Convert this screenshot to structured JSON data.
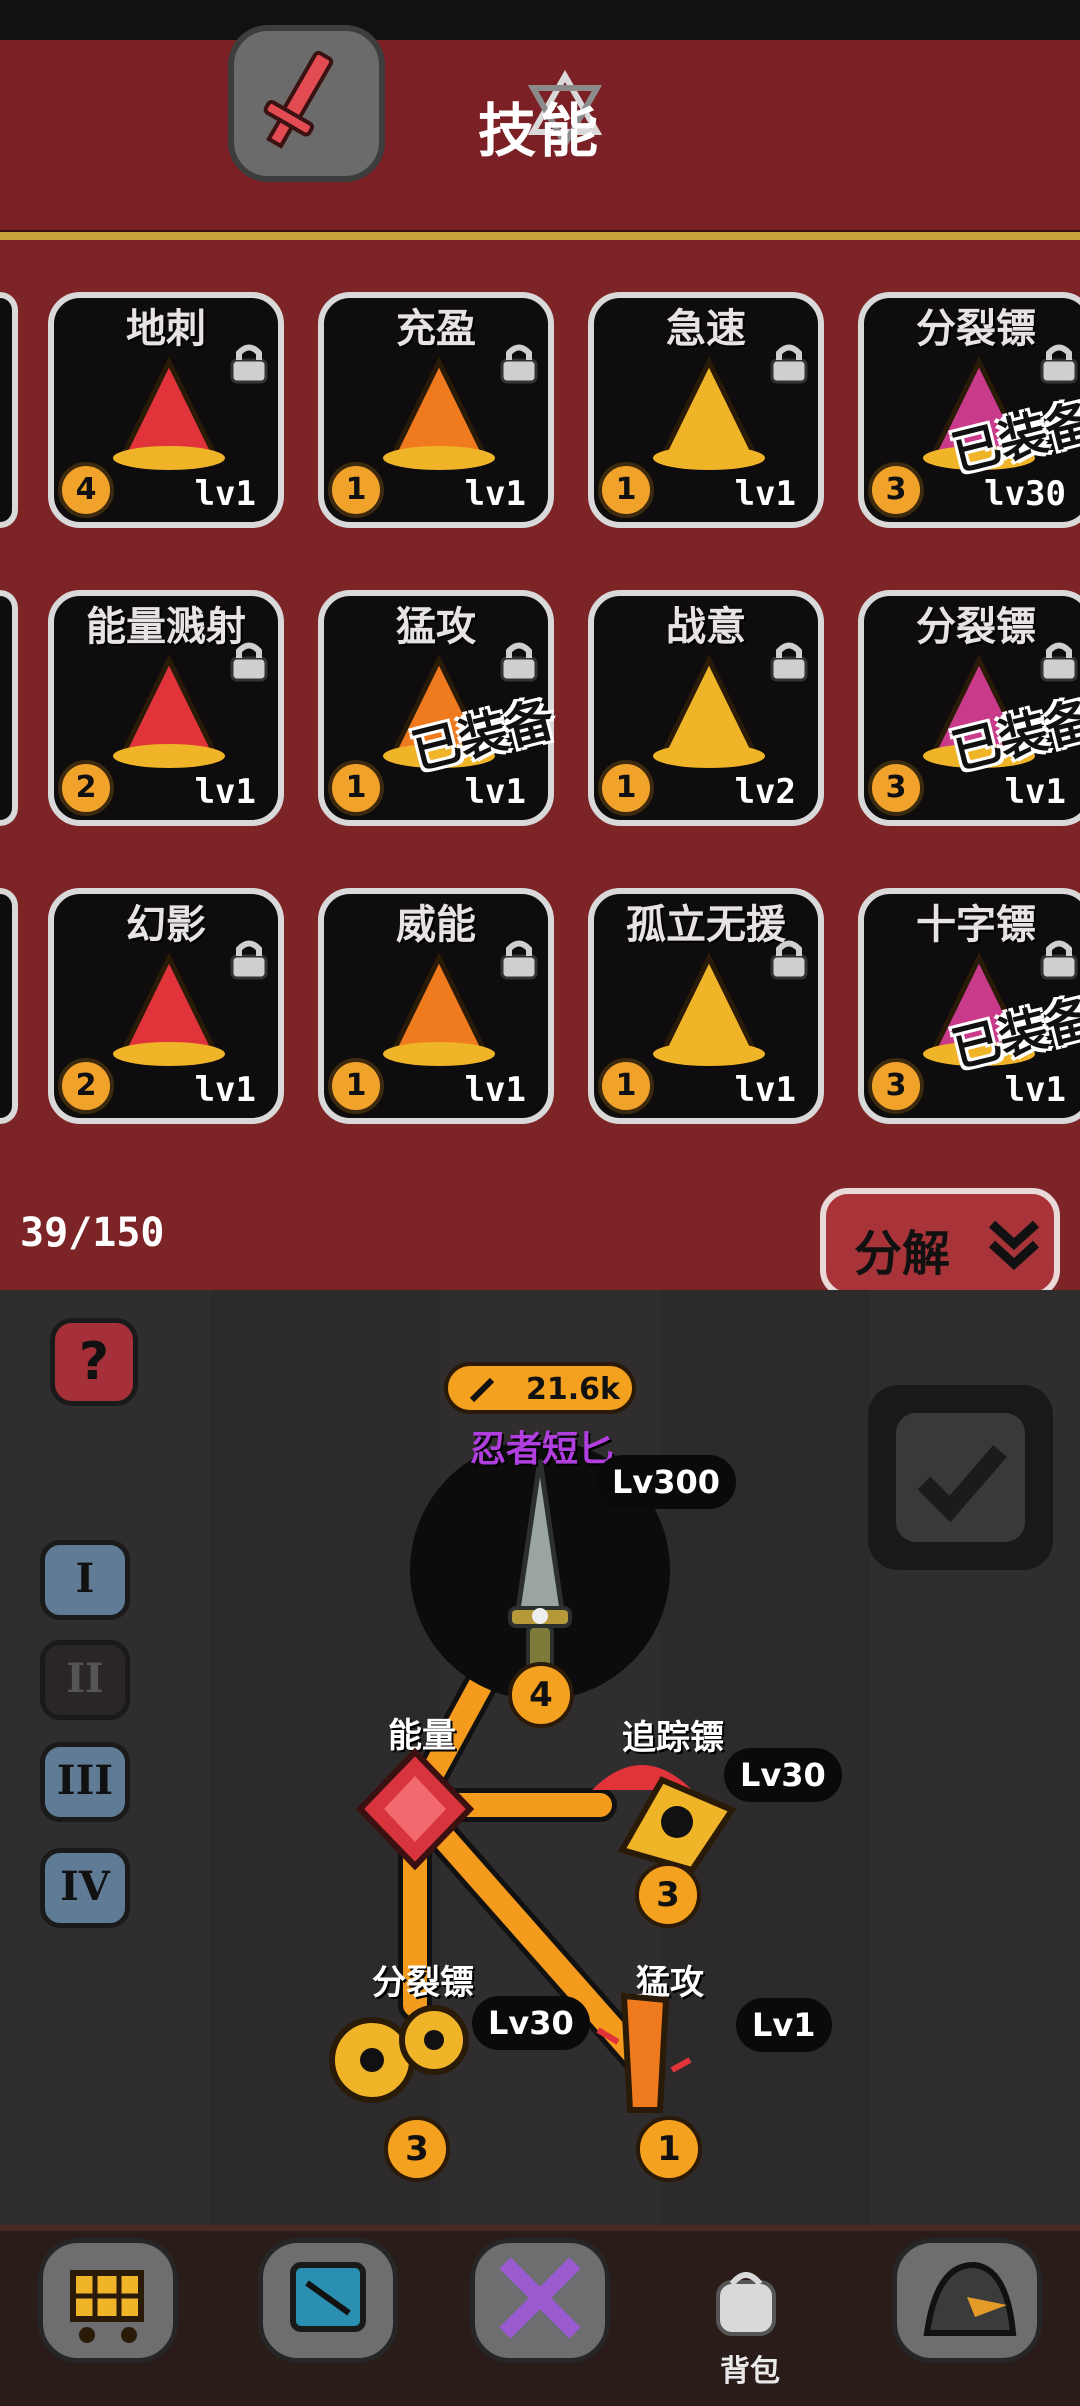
{
  "header": {
    "title": "技能"
  },
  "skills": [
    {
      "name": "地刺",
      "level": "lv1",
      "count": "4",
      "equipped": false
    },
    {
      "name": "充盈",
      "level": "lv1",
      "count": "1",
      "equipped": false
    },
    {
      "name": "急速",
      "level": "lv1",
      "count": "1",
      "equipped": false
    },
    {
      "name": "分裂镖",
      "level": "lv30",
      "count": "3",
      "equipped": true
    },
    {
      "name": "能量溅射",
      "level": "lv1",
      "count": "2",
      "equipped": false
    },
    {
      "name": "猛攻",
      "level": "lv1",
      "count": "1",
      "equipped": true
    },
    {
      "name": "战意",
      "level": "lv2",
      "count": "1",
      "equipped": false
    },
    {
      "name": "分裂镖",
      "level": "lv1",
      "count": "3",
      "equipped": true
    },
    {
      "name": "幻影",
      "level": "lv1",
      "count": "2",
      "equipped": false
    },
    {
      "name": "威能",
      "level": "lv1",
      "count": "1",
      "equipped": false
    },
    {
      "name": "孤立无援",
      "level": "lv1",
      "count": "1",
      "equipped": false
    },
    {
      "name": "十字镖",
      "level": "lv1",
      "count": "3",
      "equipped": true
    }
  ],
  "equipped_label": "已装备",
  "inventory": {
    "count": "39/150"
  },
  "decompose": {
    "label": "分解"
  },
  "help": {
    "label": "?"
  },
  "tiers": [
    "I",
    "II",
    "III",
    "IV"
  ],
  "weapon": {
    "power": "21.6k",
    "name": "忍者短匕",
    "level": "Lv300",
    "slots": "4"
  },
  "tree": {
    "energy": {
      "label": "能量"
    },
    "tracking": {
      "label": "追踪镖",
      "level": "Lv30",
      "count": "3"
    },
    "split": {
      "label": "分裂镖",
      "level": "Lv30",
      "count": "3"
    },
    "assault": {
      "label": "猛攻",
      "level": "Lv1",
      "count": "1"
    }
  },
  "nav": {
    "bag_label": "背包"
  },
  "colors": {
    "banner": "#7b2024",
    "panel": "#7c2426",
    "accent": "#f4a11f",
    "weapon_name": "#b13fe0"
  }
}
